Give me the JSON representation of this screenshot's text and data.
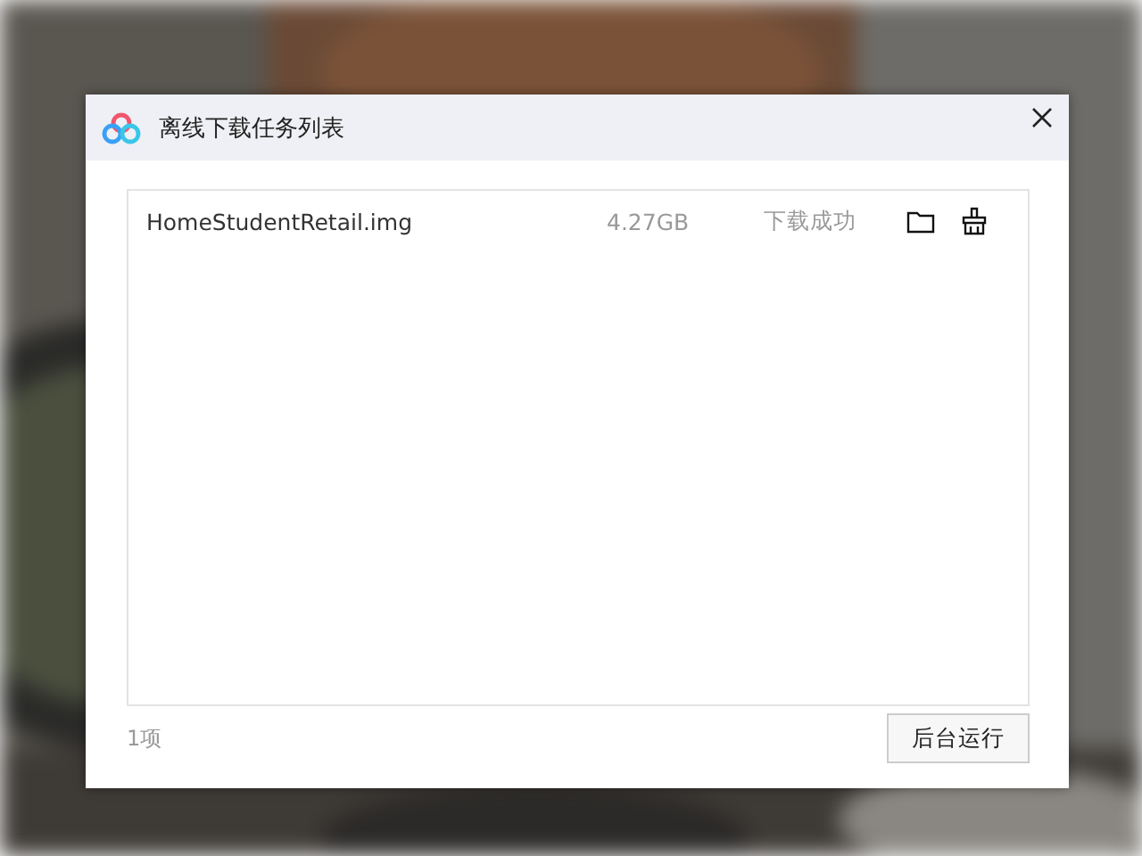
{
  "window": {
    "title": "离线下载任务列表"
  },
  "tasks": [
    {
      "name": "HomeStudentRetail.img",
      "size": "4.27GB",
      "status": "下载成功"
    }
  ],
  "footer": {
    "count": "1项",
    "button": "后台运行"
  }
}
